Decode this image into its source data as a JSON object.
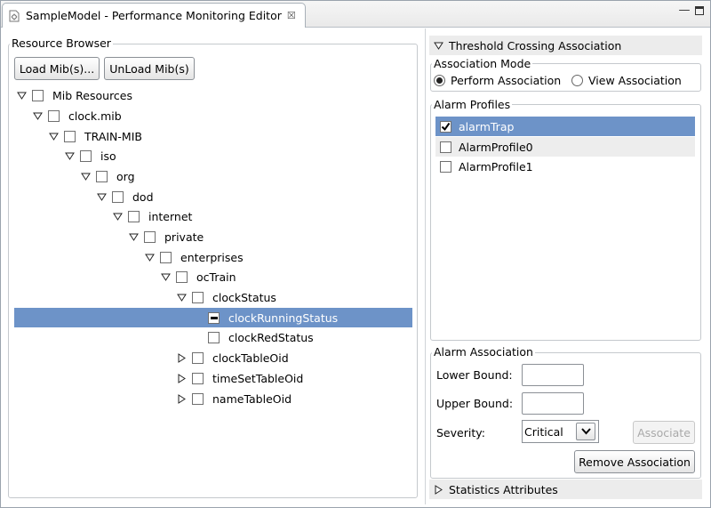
{
  "editor": {
    "tab_title": "SampleModel - Performance Monitoring Editor",
    "tab_close_glyph": "☒",
    "minimize_glyph": "—"
  },
  "resource_browser": {
    "title": "Resource Browser",
    "load_button": "Load Mib(s)...",
    "unload_button": "UnLoad Mib(s)",
    "tree": [
      {
        "label": "Mib Resources",
        "expanded": true,
        "checked": false
      },
      {
        "label": "clock.mib",
        "expanded": true,
        "checked": false
      },
      {
        "label": "TRAIN-MIB",
        "expanded": true,
        "checked": false
      },
      {
        "label": "iso",
        "expanded": true,
        "checked": false
      },
      {
        "label": "org",
        "expanded": true,
        "checked": false
      },
      {
        "label": "dod",
        "expanded": true,
        "checked": false
      },
      {
        "label": "internet",
        "expanded": true,
        "checked": false
      },
      {
        "label": "private",
        "expanded": true,
        "checked": false
      },
      {
        "label": "enterprises",
        "expanded": true,
        "checked": false
      },
      {
        "label": "ocTrain",
        "expanded": true,
        "checked": false
      },
      {
        "label": "clockStatus",
        "expanded": true,
        "checked": false
      },
      {
        "label": "clockRunningStatus",
        "leaf": true,
        "selected": true,
        "checked": "indeterminate"
      },
      {
        "label": "clockRedStatus",
        "leaf": true,
        "checked": false
      },
      {
        "label": "clockTableOid",
        "expanded": false,
        "checked": false
      },
      {
        "label": "timeSetTableOid",
        "expanded": false,
        "checked": false
      },
      {
        "label": "nameTableOid",
        "expanded": false,
        "checked": false
      }
    ]
  },
  "threshold": {
    "section_title": "Threshold Crossing Association",
    "mode_title": "Association Mode",
    "mode_options": [
      {
        "label": "Perform Association",
        "selected": true
      },
      {
        "label": "View Association",
        "selected": false
      }
    ],
    "profiles_title": "Alarm Profiles",
    "profiles": [
      {
        "label": "alarmTrap",
        "checked": true,
        "selected": true
      },
      {
        "label": "AlarmProfile0",
        "checked": false,
        "selected": false
      },
      {
        "label": "AlarmProfile1",
        "checked": false,
        "selected": false
      }
    ],
    "alarm_assoc_title": "Alarm Association",
    "lower_bound_label": "Lower Bound:",
    "lower_bound_value": "",
    "upper_bound_label": "Upper Bound:",
    "upper_bound_value": "",
    "severity_label": "Severity:",
    "severity_value": "Critical",
    "associate_button": "Associate",
    "remove_button": "Remove Association",
    "statistics_title": "Statistics Attributes"
  },
  "colors": {
    "selection": "#6d93c8",
    "section_header": "#ececec"
  }
}
